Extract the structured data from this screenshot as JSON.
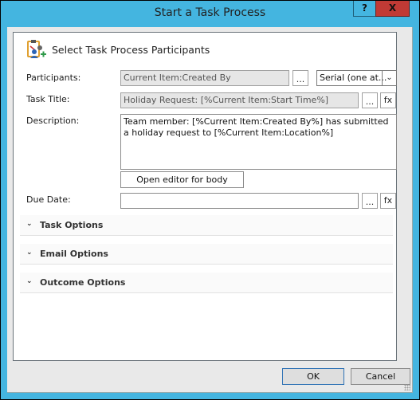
{
  "window": {
    "title": "Start a Task Process",
    "help_label": "?",
    "close_label": "X"
  },
  "header": {
    "text": "Select Task Process Participants",
    "icon": "task-participants-icon"
  },
  "form": {
    "participants": {
      "label": "Participants:",
      "value": "Current Item:Created By",
      "browse_label": "...",
      "order_selected": "Serial (one at...",
      "order_arrow": "⌄"
    },
    "task_title": {
      "label": "Task Title:",
      "value": "Holiday Request: [%Current Item:Start Time%]",
      "browse_label": "...",
      "fx_label": "fx"
    },
    "description": {
      "label": "Description:",
      "value": "Team member: [%Current Item:Created By%] has submitted a holiday request to [%Current Item:Location%]",
      "editor_button": "Open editor for body"
    },
    "due_date": {
      "label": "Due Date:",
      "value": "",
      "browse_label": "...",
      "fx_label": "fx"
    }
  },
  "sections": [
    {
      "label": "Task Options",
      "chevron": "⌄"
    },
    {
      "label": "Email Options",
      "chevron": "⌄"
    },
    {
      "label": "Outcome Options",
      "chevron": "⌄"
    }
  ],
  "buttons": {
    "ok": "OK",
    "cancel": "Cancel"
  },
  "colors": {
    "frame": "#44b5e0",
    "close": "#c13a35",
    "ok_border": "#2f72b5"
  }
}
